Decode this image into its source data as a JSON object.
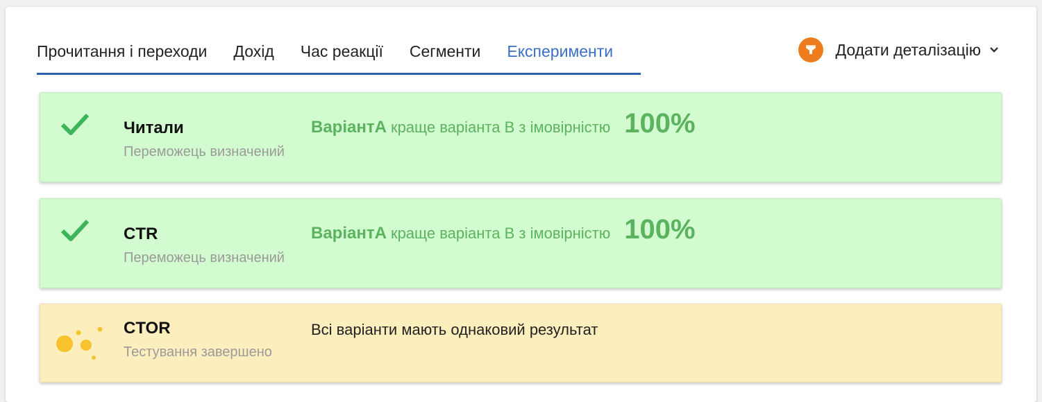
{
  "tabs": [
    {
      "label": "Прочитання і переходи"
    },
    {
      "label": "Дохід"
    },
    {
      "label": "Час реакції"
    },
    {
      "label": "Сегменти"
    },
    {
      "label": "Експерименти"
    }
  ],
  "active_tab": "Експерименти",
  "detail": {
    "label": "Додати деталізацію",
    "icon": "funnel-icon",
    "icon_color": "#f07d1d"
  },
  "colors": {
    "accent": "#3a6fc4",
    "winner_bg": "#d3fbd0",
    "winner_text": "#5bb25f",
    "neutral_bg": "#fdeebd"
  },
  "cards": [
    {
      "status": "winner",
      "icon": "check-icon",
      "name": "Читали",
      "subtitle": "Переможець визначений",
      "variant": "ВаріантА",
      "text": "краще варіанта В з імовірністю",
      "percent": "100%"
    },
    {
      "status": "winner",
      "icon": "check-icon",
      "name": "CTR",
      "subtitle": "Переможець визначений",
      "variant": "ВаріантА",
      "text": "краще варіанта В з імовірністю",
      "percent": "100%"
    },
    {
      "status": "neutral",
      "icon": "bubbles-icon",
      "name": "CTOR",
      "subtitle": "Тестування завершено",
      "text": "Всі варіанти мають однаковий результат"
    }
  ]
}
